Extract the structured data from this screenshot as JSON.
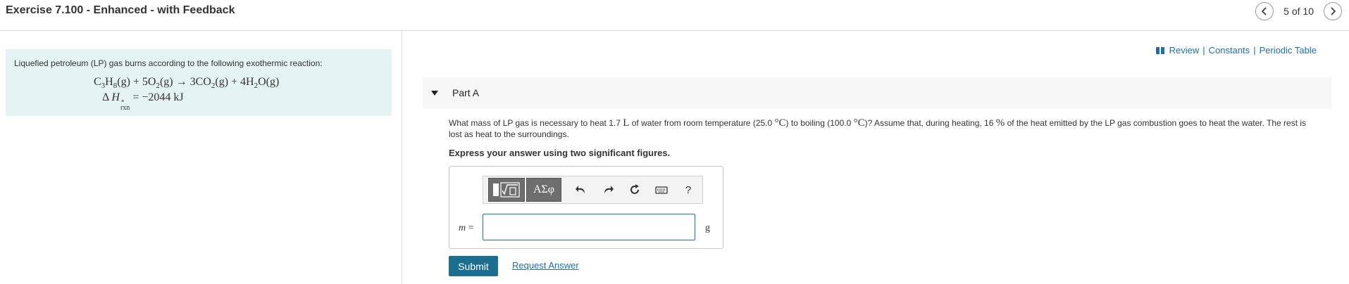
{
  "header": {
    "title": "Exercise 7.100 - Enhanced - with Feedback",
    "pager_text": "5 of 10"
  },
  "intro": {
    "text": "Liquefied petroleum (LP) gas burns according to the following exothermic reaction:",
    "equation": {
      "p1": "C",
      "s1": "3",
      "p2": "H",
      "s2": "8",
      "p3": "(g) + 5O",
      "s3": "2",
      "p4": "(g) → 3CO",
      "s4": "2",
      "p5": "(g) + 4H",
      "s5": "2",
      "p6": "O(g)"
    },
    "enthalpy": {
      "delta": "Δ",
      "symbol": "H",
      "sup": "∘",
      "sub": "rxn",
      "value": "= −2044 kJ"
    }
  },
  "links": {
    "review": "Review",
    "sep1": "|",
    "constants": "Constants",
    "sep2": "|",
    "periodic_table": "Periodic Table"
  },
  "part": {
    "title": "Part A",
    "q1": "What mass of LP gas is necessary to heat 1.7 ",
    "q_unit_l": "L",
    "q2": " of water from room temperature (25.0 ",
    "q_deg1": "°C",
    "q3": ") to boiling (100.0 ",
    "q_deg2": "°C",
    "q4": ")? Assume that, during heating, 16 ",
    "q_pct": "%",
    "q5": " of the heat emitted by the LP gas combustion goes to heat the water. The rest is lost as heat to the surroundings.",
    "instruction": "Express your answer using two significant figures."
  },
  "answer": {
    "greek_label": "ΑΣφ",
    "help_label": "?",
    "variable": "m",
    "equals": " =",
    "value": "",
    "unit": "g"
  },
  "actions": {
    "submit": "Submit",
    "request_answer": "Request Answer"
  },
  "colors": {
    "accent": "#1c6e8f",
    "link": "#1d6fa5",
    "intro_bg": "#e6f3f5"
  }
}
